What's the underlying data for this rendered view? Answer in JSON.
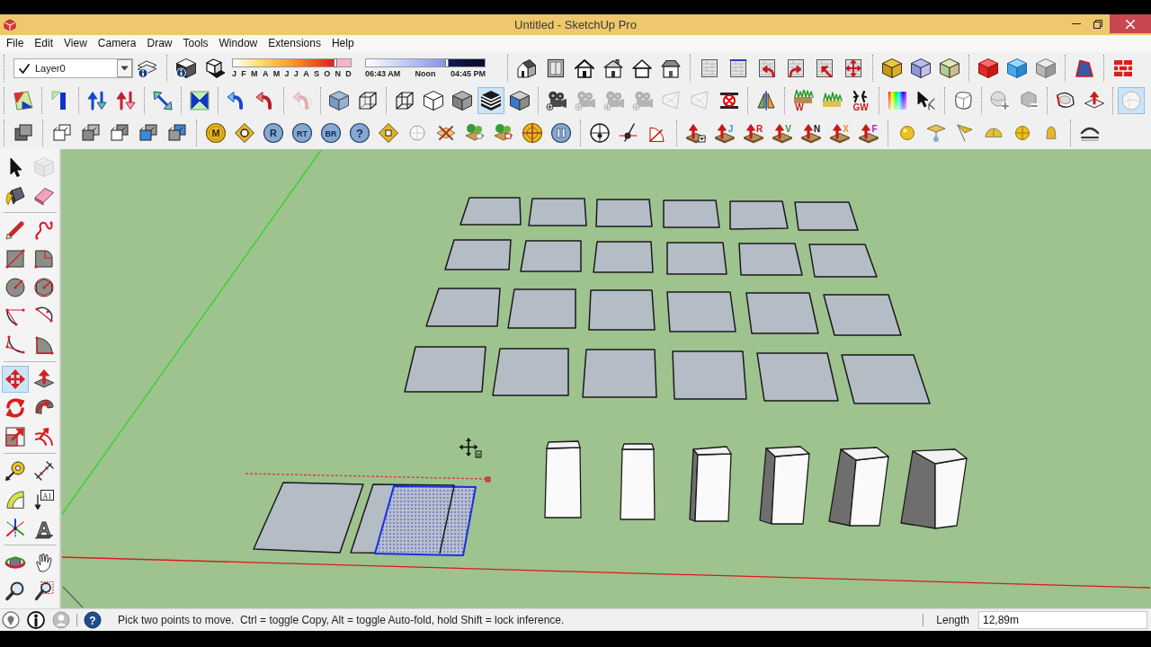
{
  "window": {
    "title": "Untitled - SketchUp Pro"
  },
  "menu": [
    "File",
    "Edit",
    "View",
    "Camera",
    "Draw",
    "Tools",
    "Window",
    "Extensions",
    "Help"
  ],
  "toolbar_rows": [
    [
      {
        "kind": "layers",
        "current": "Layer0",
        "buttons": [
          {
            "selected": false
          }
        ]
      },
      {
        "kind": "shadows",
        "buttons": [
          {
            "selected": false
          },
          {
            "selected": false
          }
        ],
        "date_slider": {
          "level": 0.87,
          "labels": [
            "J",
            "F",
            "M",
            "A",
            "M",
            "J",
            "J",
            "A",
            "S",
            "O",
            "N",
            "D"
          ]
        },
        "time_slider": {
          "level": 0.68,
          "labels": [
            "06:43 AM",
            "Noon",
            "04:45 PM"
          ]
        }
      },
      {
        "kind": "buttons",
        "buttons": [
          {
            "selected": false
          },
          {
            "selected": false
          },
          {
            "selected": false
          },
          {
            "selected": false
          },
          {
            "selected": false
          },
          {
            "selected": false
          }
        ]
      },
      {
        "kind": "buttons",
        "buttons": [
          {
            "selected": false
          },
          {
            "selected": false
          },
          {
            "selected": false
          },
          {
            "selected": false
          },
          {
            "selected": false
          },
          {
            "selected": false
          }
        ]
      },
      {
        "kind": "buttons",
        "buttons": [
          {
            "selected": false
          },
          {
            "selected": false
          },
          {
            "selected": false
          }
        ]
      },
      {
        "kind": "buttons",
        "buttons": [
          {
            "selected": false
          },
          {
            "selected": false
          },
          {
            "selected": false
          }
        ]
      },
      {
        "kind": "buttons",
        "buttons": [
          {
            "selected": false
          }
        ]
      },
      {
        "kind": "buttons",
        "buttons": [
          {
            "selected": false
          }
        ]
      }
    ],
    [
      {
        "kind": "buttons",
        "buttons": [
          {
            "selected": false,
            "disabled": false
          }
        ]
      },
      {
        "kind": "buttons",
        "buttons": [
          {
            "selected": false,
            "disabled": false
          }
        ]
      },
      {
        "kind": "buttons",
        "buttons": [
          {
            "selected": false,
            "disabled": false
          },
          {
            "selected": false,
            "disabled": false
          }
        ]
      },
      {
        "kind": "buttons",
        "buttons": [
          {
            "selected": false,
            "disabled": false
          }
        ]
      },
      {
        "kind": "buttons",
        "buttons": [
          {
            "selected": false,
            "disabled": false
          }
        ]
      },
      {
        "kind": "buttons",
        "buttons": [
          {
            "selected": false,
            "disabled": false
          },
          {
            "selected": false,
            "disabled": false
          }
        ]
      },
      {
        "kind": "buttons",
        "buttons": [
          {
            "selected": false,
            "disabled": true
          }
        ]
      },
      {
        "kind": "buttons",
        "buttons": [
          {
            "selected": false,
            "disabled": false
          },
          {
            "selected": false,
            "disabled": false
          }
        ]
      },
      {
        "kind": "buttons",
        "buttons": [
          {
            "selected": false,
            "disabled": false
          },
          {
            "selected": false,
            "disabled": false
          },
          {
            "selected": false,
            "disabled": false
          },
          {
            "selected": true,
            "disabled": false
          },
          {
            "selected": false,
            "disabled": false
          }
        ]
      },
      {
        "kind": "buttons",
        "buttons": [
          {
            "selected": false,
            "disabled": false
          },
          {
            "selected": false,
            "disabled": true
          },
          {
            "selected": false,
            "disabled": true
          },
          {
            "selected": false,
            "disabled": true
          },
          {
            "selected": false,
            "disabled": true
          },
          {
            "selected": false,
            "disabled": true
          },
          {
            "selected": false,
            "disabled": false
          }
        ]
      },
      {
        "kind": "buttons",
        "buttons": [
          {
            "selected": false,
            "disabled": false
          }
        ]
      },
      {
        "kind": "buttons",
        "buttons": [
          {
            "selected": false,
            "disabled": false,
            "label": "W"
          },
          {
            "selected": false,
            "disabled": false
          },
          {
            "selected": false,
            "disabled": false,
            "label": "GW"
          }
        ]
      },
      {
        "kind": "buttons",
        "buttons": [
          {
            "selected": false,
            "disabled": false
          },
          {
            "selected": false,
            "disabled": false
          }
        ]
      },
      {
        "kind": "buttons",
        "buttons": [
          {
            "selected": false,
            "disabled": false
          }
        ]
      },
      {
        "kind": "buttons",
        "buttons": [
          {
            "selected": false,
            "disabled": false
          },
          {
            "selected": false,
            "disabled": false
          }
        ]
      },
      {
        "kind": "buttons",
        "buttons": [
          {
            "selected": false,
            "disabled": false
          },
          {
            "selected": false,
            "disabled": false
          }
        ]
      },
      {
        "kind": "buttons",
        "buttons": [
          {
            "selected": true,
            "disabled": false
          }
        ]
      }
    ],
    [
      {
        "kind": "buttons",
        "buttons": [
          {
            "selected": false
          }
        ]
      },
      {
        "kind": "buttons",
        "buttons": [
          {
            "selected": false
          },
          {
            "selected": false
          },
          {
            "selected": false
          },
          {
            "selected": false
          },
          {
            "selected": false
          }
        ]
      },
      {
        "kind": "buttons",
        "buttons": [
          {
            "selected": false,
            "label": "M"
          },
          {
            "selected": false
          },
          {
            "selected": false,
            "label": "R"
          },
          {
            "selected": false,
            "label": "RT"
          },
          {
            "selected": false,
            "label": "BR"
          },
          {
            "selected": false,
            "label": "?"
          },
          {
            "selected": false
          },
          {
            "selected": false
          },
          {
            "selected": false
          },
          {
            "selected": false
          },
          {
            "selected": false
          },
          {
            "selected": false
          },
          {
            "selected": false
          }
        ]
      },
      {
        "kind": "buttons",
        "buttons": [
          {
            "selected": false
          },
          {
            "selected": false
          },
          {
            "selected": false
          }
        ]
      },
      {
        "kind": "buttons",
        "buttons": [
          {
            "selected": false
          },
          {
            "selected": false,
            "label": "J"
          },
          {
            "selected": false,
            "label": "R"
          },
          {
            "selected": false,
            "label": "V"
          },
          {
            "selected": false,
            "label": "N"
          },
          {
            "selected": false,
            "label": "X"
          },
          {
            "selected": false,
            "label": "F"
          }
        ]
      },
      {
        "kind": "buttons",
        "buttons": [
          {
            "selected": false
          },
          {
            "selected": false
          },
          {
            "selected": false
          },
          {
            "selected": false
          },
          {
            "selected": false
          },
          {
            "selected": false
          }
        ]
      },
      {
        "kind": "buttons",
        "buttons": [
          {
            "selected": false
          }
        ]
      }
    ]
  ],
  "tool_palette": [
    [
      {
        "selected": false,
        "disabled": false
      },
      {
        "selected": false,
        "disabled": true
      },
      {
        "selected": false,
        "disabled": false
      },
      {
        "selected": false,
        "disabled": false
      }
    ],
    [
      {
        "selected": false,
        "disabled": false
      },
      {
        "selected": false,
        "disabled": false
      },
      {
        "selected": false,
        "disabled": false
      },
      {
        "selected": false,
        "disabled": false
      },
      {
        "selected": false,
        "disabled": false
      },
      {
        "selected": false,
        "disabled": false
      },
      {
        "selected": false,
        "disabled": false
      },
      {
        "selected": false,
        "disabled": false
      },
      {
        "selected": false,
        "disabled": false
      },
      {
        "selected": false,
        "disabled": false
      }
    ],
    [
      {
        "selected": true,
        "disabled": false
      },
      {
        "selected": false,
        "disabled": false
      },
      {
        "selected": false,
        "disabled": false
      },
      {
        "selected": false,
        "disabled": false
      },
      {
        "selected": false,
        "disabled": false
      },
      {
        "selected": false,
        "disabled": false
      }
    ],
    [
      {
        "selected": false,
        "disabled": false
      },
      {
        "selected": false,
        "disabled": false
      },
      {
        "selected": false,
        "disabled": false
      },
      {
        "selected": false,
        "disabled": false,
        "label": "A1"
      },
      {
        "selected": false,
        "disabled": false
      },
      {
        "selected": false,
        "disabled": false,
        "label": "A"
      }
    ],
    [
      {
        "selected": false,
        "disabled": false
      },
      {
        "selected": false,
        "disabled": false
      },
      {
        "selected": false,
        "disabled": false
      },
      {
        "selected": false,
        "disabled": false
      }
    ]
  ],
  "status_bar": {
    "help_mark": "?",
    "hint": "Pick two points to move.  Ctrl = toggle Copy, Alt = toggle Auto-fold, hold Shift = lock inference.",
    "measure_label": "Length",
    "measure_value": "12,89m"
  }
}
